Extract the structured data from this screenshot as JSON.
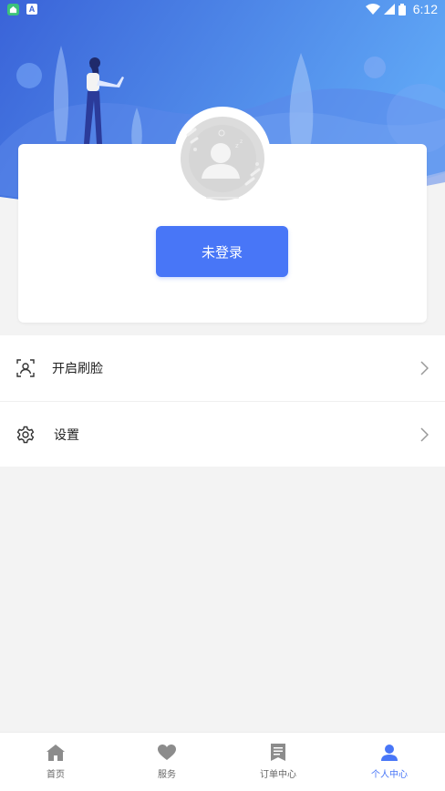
{
  "status_bar": {
    "time": "6:12",
    "icons": [
      "app-icon",
      "a-notification-icon",
      "wifi-icon",
      "signal-icon",
      "battery-icon"
    ],
    "a_badge_text": "A"
  },
  "profile": {
    "login_button": "未登录"
  },
  "menu": {
    "items": [
      {
        "label": "开启刷脸",
        "icon": "face-scan-icon"
      },
      {
        "label": "设置",
        "icon": "gear-icon"
      }
    ]
  },
  "tabbar": {
    "tabs": [
      {
        "label": "首页",
        "icon": "home-icon"
      },
      {
        "label": "服务",
        "icon": "heart-icon"
      },
      {
        "label": "订单中心",
        "icon": "bookmark-icon"
      },
      {
        "label": "个人中心",
        "icon": "person-icon",
        "active": true
      }
    ]
  },
  "colors": {
    "accent": "#4876f7",
    "hero_gradient_start": "#3a63d8",
    "hero_gradient_end": "#5fa6f5",
    "background": "#f3f3f3"
  }
}
